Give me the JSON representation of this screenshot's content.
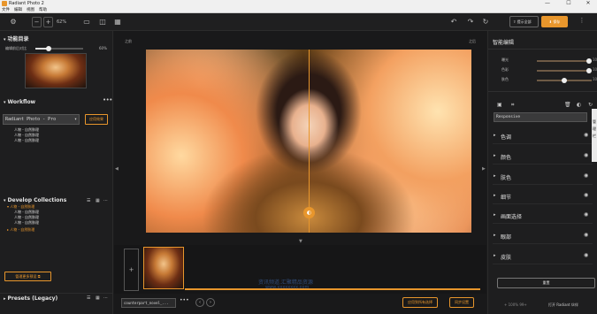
{
  "window": {
    "title": "Radiant Photo 2",
    "controls": [
      "—",
      "☐",
      "✕"
    ]
  },
  "menu": [
    "文件",
    "编辑",
    "视图",
    "帮助"
  ],
  "toolbar": {
    "zoom": "62%",
    "export_label": "提示全部",
    "save_label": "保存",
    "more": "⋮"
  },
  "left": {
    "feature_catalog": {
      "title": "功能目录",
      "slider_label": "编辑前后对比",
      "slider_value": "60%",
      "slider_fraction": 0.27
    },
    "workflow": {
      "title": "Workflow",
      "selected": "Radiant Photo - Pro",
      "apply_label": "应用效果",
      "items": [
        "人物 - 自然肤理",
        "人物 - 自然肤理",
        "人物 - 自然肤理"
      ]
    },
    "develop_collections": {
      "title": "Develop Collections",
      "items": [
        {
          "label": "人物 - 自然肤理",
          "active": true,
          "prefix": "▾"
        },
        {
          "label": "人物 - 自然肤理",
          "active": false,
          "prefix": ""
        },
        {
          "label": "人物 - 自然肤理",
          "active": false,
          "prefix": ""
        },
        {
          "label": "人物 - 自然肤理",
          "active": false,
          "prefix": ""
        },
        {
          "label": "人物 - 自然肤理",
          "active": true,
          "prefix": "▸"
        }
      ]
    },
    "manage_label": "管理更多预设",
    "presets": {
      "title": "Presets (Legacy)"
    }
  },
  "center": {
    "before_label": "之前",
    "after_label": "之后",
    "file_tab": "counterpart_novel_...",
    "view_btn_1": "应用到所有选择",
    "view_btn_2": "同步设置",
    "watermark": "资讯频道.汇聚精品资源",
    "watermark_sub": "www.xxxxxxxx.com"
  },
  "right": {
    "title": "智能编辑",
    "adjustments": [
      {
        "label": "曝光",
        "value": "100",
        "fraction": 0.95
      },
      {
        "label": "色彩",
        "value": "100",
        "fraction": 0.95
      },
      {
        "label": "肤色",
        "value": "100",
        "fraction": 0.5
      }
    ],
    "preset_selected": "Responsive",
    "categories": [
      "色调",
      "颜色",
      "肤色",
      "细节",
      "画面选择",
      "眼部",
      "皮肤"
    ],
    "reset_label": "重置",
    "footer_left": "+ 100% 99+",
    "footer_right": "打开 Radiant 伙伴"
  },
  "side_strip": [
    "管",
    "理",
    "栏"
  ],
  "colors": {
    "accent": "#e8962c",
    "panel": "#1e1e1f",
    "background": "#1b1b1c"
  }
}
